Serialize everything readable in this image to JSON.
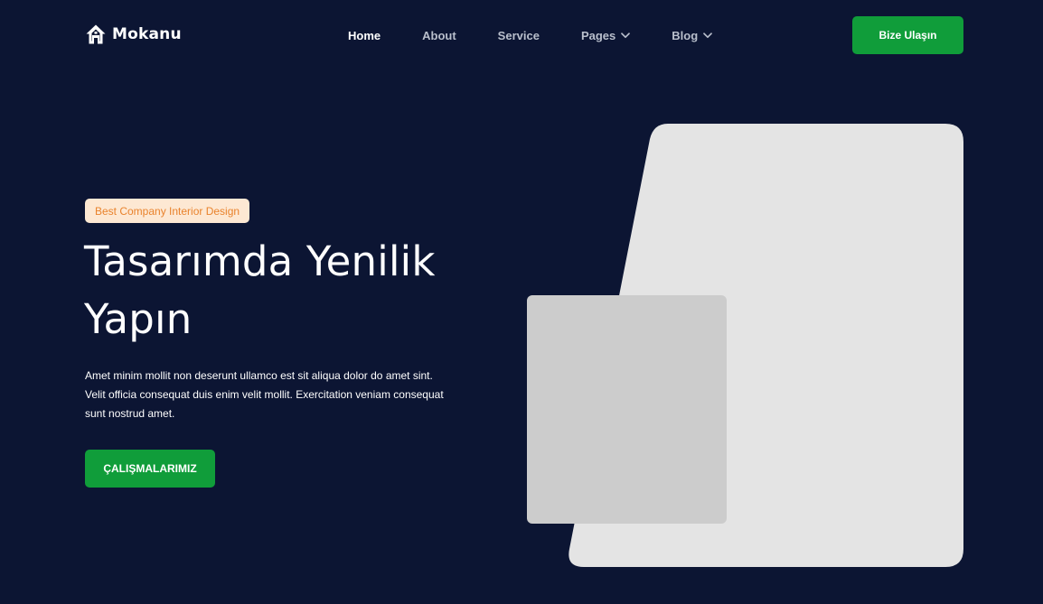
{
  "brand": {
    "name": "Mokanu",
    "icon": "home-icon"
  },
  "nav": {
    "items": [
      {
        "label": "Home",
        "active": true,
        "dropdown": false
      },
      {
        "label": "About",
        "active": false,
        "dropdown": false
      },
      {
        "label": "Service",
        "active": false,
        "dropdown": false
      },
      {
        "label": "Pages",
        "active": false,
        "dropdown": true
      },
      {
        "label": "Blog",
        "active": false,
        "dropdown": true
      }
    ],
    "cta_label": "Bize Ulaşın"
  },
  "hero": {
    "badge": "Best Company Interior Design",
    "title": "Tasarımda Yenilik Yapın",
    "text": "Amet minim mollit non deserunt ullamco est sit aliqua dolor do amet sint. Velit officia consequat duis enim velit mollit. Exercitation veniam consequat sunt nostrud amet.",
    "cta_label": "ÇALIŞMALARIMIZ"
  },
  "colors": {
    "background": "#0c1533",
    "accent": "#109d3a",
    "badge_bg": "#fde8d3",
    "badge_text": "#e9832d",
    "image_placeholder_large": "#e4e4e4",
    "image_placeholder_small": "#cccccc"
  }
}
